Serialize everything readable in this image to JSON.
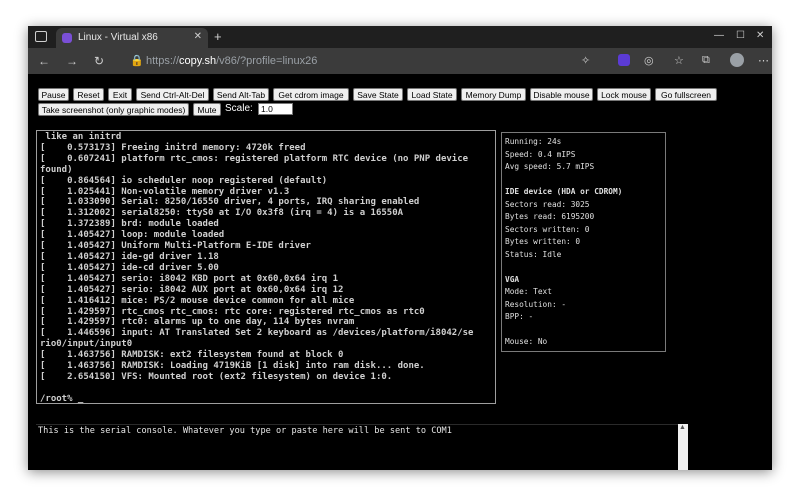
{
  "browser": {
    "tab_title": "Linux - Virtual x86",
    "address_prefix": "https://",
    "address_host": "copy.sh",
    "address_path": "/v86/?profile=linux26"
  },
  "controls": {
    "buttons": [
      "Pause",
      "Reset",
      "Exit",
      "Send Ctrl-Alt-Del",
      "Send Alt-Tab",
      "Get cdrom image",
      "Save State",
      "Load State",
      "Memory Dump",
      "Disable mouse",
      "Lock mouse",
      "Go fullscreen",
      "Take screenshot (only graphic modes)",
      "Mute"
    ],
    "scale_label": "Scale:",
    "scale_value": "1.0"
  },
  "screen_lines": [
    " like an initrd",
    "[    0.573173] Freeing initrd memory: 4720k freed",
    "[    0.607241] platform rtc_cmos: registered platform RTC device (no PNP device",
    "found)",
    "[    0.864564] io scheduler noop registered (default)",
    "[    1.025441] Non-volatile memory driver v1.3",
    "[    1.033090] Serial: 8250/16550 driver, 4 ports, IRQ sharing enabled",
    "[    1.312002] serial8250: ttyS0 at I/O 0x3f8 (irq = 4) is a 16550A",
    "[    1.372389] brd: module loaded",
    "[    1.405427] loop: module loaded",
    "[    1.405427] Uniform Multi-Platform E-IDE driver",
    "[    1.405427] ide-gd driver 1.18",
    "[    1.405427] ide-cd driver 5.00",
    "[    1.405427] serio: i8042 KBD port at 0x60,0x64 irq 1",
    "[    1.405427] serio: i8042 AUX port at 0x60,0x64 irq 12",
    "[    1.416412] mice: PS/2 mouse device common for all mice",
    "[    1.429597] rtc_cmos rtc_cmos: rtc core: registered rtc_cmos as rtc0",
    "[    1.429597] rtc0: alarms up to one day, 114 bytes nvram",
    "[    1.446596] input: AT Translated Set 2 keyboard as /devices/platform/i8042/se",
    "rio0/input/input0",
    "[    1.463756] RAMDISK: ext2 filesystem found at block 0",
    "[    1.463756] RAMDISK: Loading 4719KiB [1 disk] into ram disk... done.",
    "[    2.654150] VFS: Mounted root (ext2 filesystem) on device 1:0.",
    "",
    "/root% _"
  ],
  "stats": {
    "running": "Running: 24s",
    "speed": "Speed: 0.4 mIPS",
    "avg_speed": "Avg speed: 5.7 mIPS",
    "ide_heading": "IDE device (HDA or CDROM)",
    "sectors_read": "Sectors read: 3025",
    "bytes_read": "Bytes read: 6195200",
    "sectors_written": "Sectors written: 0",
    "bytes_written": "Bytes written: 0",
    "status": "Status: Idle",
    "vga_heading": "VGA",
    "mode": "Mode: Text",
    "resolution": "Resolution: -",
    "bpp": "BPP: -",
    "mouse": "Mouse: No"
  },
  "serial_console": "This is the serial console. Whatever you type or paste here will be sent to COM1",
  "colors": {
    "page_background": "#000000",
    "browser_chrome": "#3b3b3b",
    "tab_strip": "#1f1f1f",
    "terminal_text": "#cfcfcf",
    "button_face": "#efefef"
  }
}
